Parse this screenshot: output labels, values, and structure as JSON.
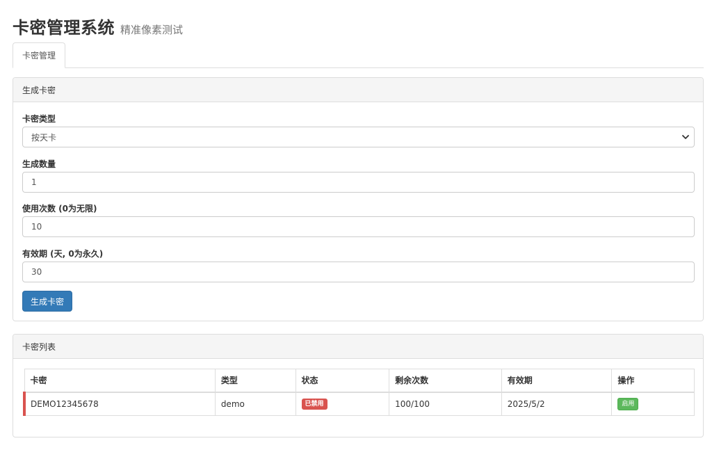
{
  "header": {
    "title": "卡密管理系统",
    "subtitle": "精准像素测试"
  },
  "tabs": [
    {
      "label": "卡密管理",
      "active": true
    }
  ],
  "generate_panel": {
    "heading": "生成卡密",
    "fields": {
      "type": {
        "label": "卡密类型",
        "value": "按天卡"
      },
      "quantity": {
        "label": "生成数量",
        "value": "1"
      },
      "uses": {
        "label": "使用次数 (0为无限)",
        "value": "10"
      },
      "validity": {
        "label": "有效期 (天, 0为永久)",
        "value": "30"
      }
    },
    "submit_label": "生成卡密"
  },
  "list_panel": {
    "heading": "卡密列表",
    "columns": [
      "卡密",
      "类型",
      "状态",
      "剩余次数",
      "有效期",
      "操作"
    ],
    "rows": [
      {
        "card": "DEMO12345678",
        "type": "demo",
        "status": "已禁用",
        "remaining": "100/100",
        "expiry": "2025/5/2",
        "action": "启用"
      }
    ]
  },
  "colors": {
    "primary": "#337ab7",
    "danger": "#d9534f",
    "success": "#5cb85c",
    "panel_heading_bg": "#f5f5f5",
    "border": "#dddddd"
  },
  "icons": {
    "select_chevron": "chevron-down-icon"
  }
}
